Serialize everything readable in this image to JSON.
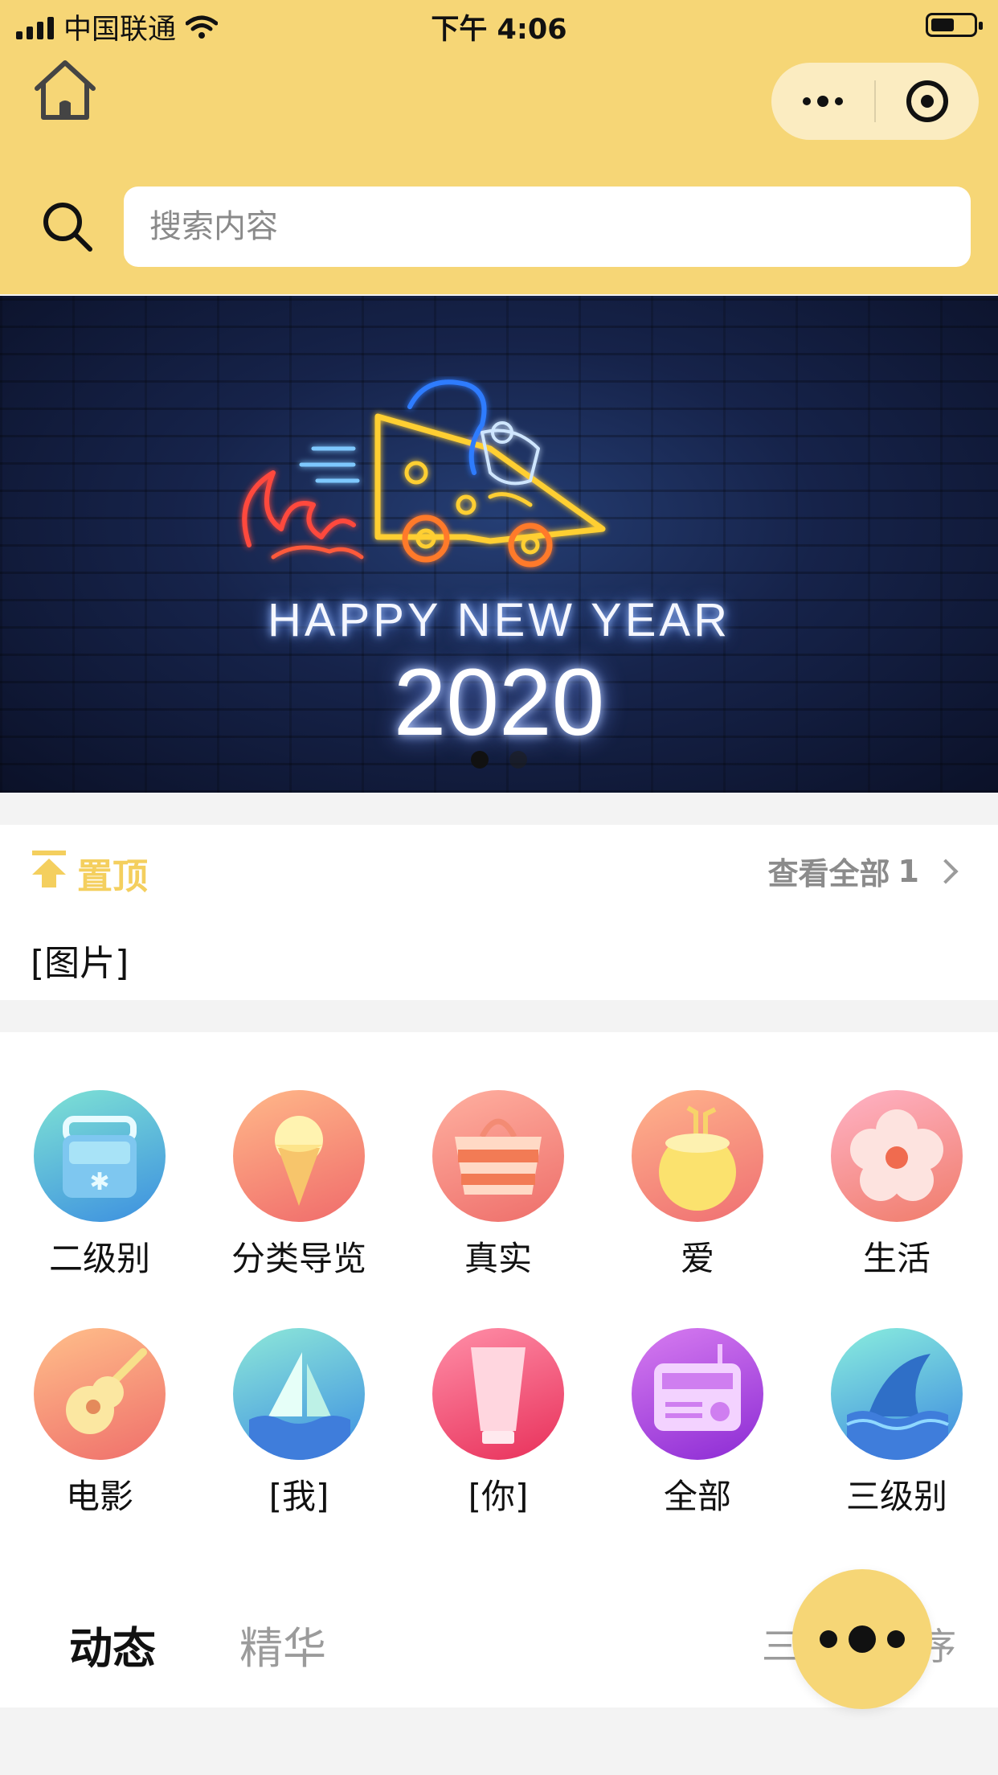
{
  "status_bar": {
    "carrier": "中国联通",
    "time": "下午 4:06"
  },
  "header": {
    "search_placeholder": "搜索内容",
    "accent_color": "#f6d676"
  },
  "banner": {
    "line1": "HAPPY NEW YEAR",
    "line2": "2020",
    "slide_count": 2,
    "active_slide": 1
  },
  "pinned": {
    "title": "置顶",
    "view_all_label": "查看全部",
    "view_all_count": "1",
    "item_text": "[图片]"
  },
  "categories": [
    {
      "label": "二级别",
      "icon": "cooler-icon"
    },
    {
      "label": "分类导览",
      "icon": "ice-cream-icon"
    },
    {
      "label": "真实",
      "icon": "bag-icon"
    },
    {
      "label": "爱",
      "icon": "coconut-icon"
    },
    {
      "label": "生活",
      "icon": "flower-icon"
    },
    {
      "label": "电影",
      "icon": "guitar-icon"
    },
    {
      "label": "[我]",
      "icon": "sailboat-icon"
    },
    {
      "label": "[你]",
      "icon": "sunscreen-icon"
    },
    {
      "label": "全部",
      "icon": "radio-icon"
    },
    {
      "label": "三级别",
      "icon": "shark-fin-icon"
    }
  ],
  "tabs": [
    {
      "label": "动态",
      "active": true
    },
    {
      "label": "精华",
      "active": false
    }
  ],
  "sort_label_left": "三",
  "sort_label_right": "序"
}
